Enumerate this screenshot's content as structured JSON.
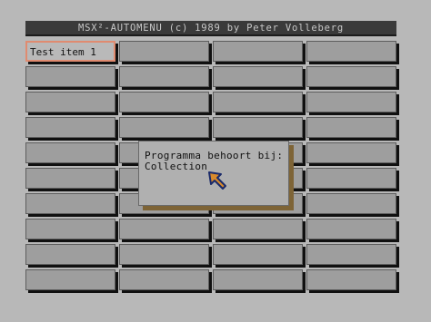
{
  "title": "MSX²-AUTOMENU  (c) 1989 by Peter Volleberg",
  "grid": {
    "rows": 10,
    "columns": 4,
    "items": [
      "Test item 1",
      "",
      "",
      "",
      "",
      "",
      "",
      "",
      "",
      "",
      "",
      "",
      "",
      "",
      "",
      "",
      "",
      "",
      "",
      "",
      "",
      "",
      "",
      "",
      "",
      "",
      "",
      "",
      "",
      "",
      "",
      "",
      "",
      "",
      "",
      "",
      "",
      "",
      "",
      ""
    ],
    "selected_index": 0
  },
  "popup": {
    "line1": "Programma behoort bij:",
    "line2": "Collection"
  },
  "cursor": {
    "icon": "arrow-cursor-icon"
  },
  "colors": {
    "background": "#b8b8b8",
    "cell": "#9e9e9e",
    "cell_shadow": "#101010",
    "selection_border": "#e08b70",
    "popup_shadow": "#7e6436",
    "cursor_fill": "#d88a2c",
    "cursor_outline": "#1a2a6a"
  }
}
